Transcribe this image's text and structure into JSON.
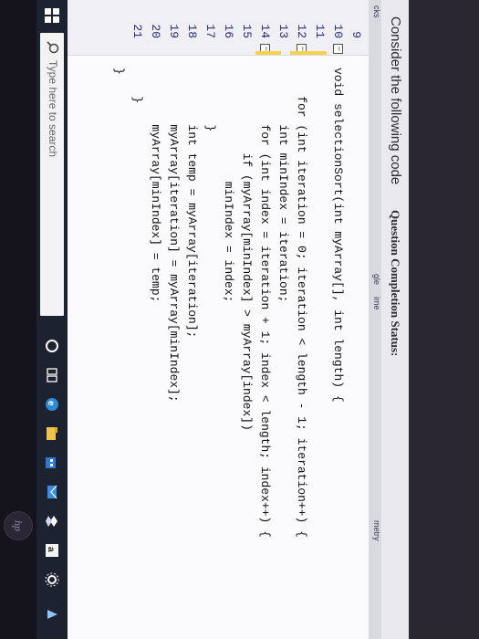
{
  "page_header": {
    "consider_text": "Consider the following code",
    "completion_status": "Question Completion Status:"
  },
  "side_tags": [
    "cks",
    "gle",
    "ime",
    "metry"
  ],
  "gutter": {
    "line_numbers": [
      "9",
      "10",
      "11",
      "12",
      "13",
      "14",
      "15",
      "16",
      "17",
      "18",
      "19",
      "20",
      "21"
    ]
  },
  "code": {
    "lines": [
      "",
      "void selectionSort(int myArray[], int length) {",
      "",
      "    for (int iteration = 0; iteration < length - 1; iteration++) {",
      "        int minIndex = iteration;",
      "        for (int index = iteration + 1; index < length; index++) {",
      "            if (myArray[minIndex] > myArray[index])",
      "                minIndex = index;",
      "        }",
      "        int temp = myArray[iteration];",
      "        myArray[iteration] = myArray[minIndex];",
      "        myArray[minIndex] = temp;",
      "    }",
      "}"
    ]
  },
  "taskbar": {
    "search_placeholder": "Type here to search",
    "icons": [
      "windows-start-icon",
      "search-icon",
      "cortana-circle-icon",
      "task-view-icon",
      "edge-icon",
      "file-explorer-icon",
      "store-icon",
      "mail-icon",
      "dropbox-icon",
      "amazon-icon",
      "settings-icon"
    ]
  },
  "bezel": {
    "brand": "hp"
  }
}
